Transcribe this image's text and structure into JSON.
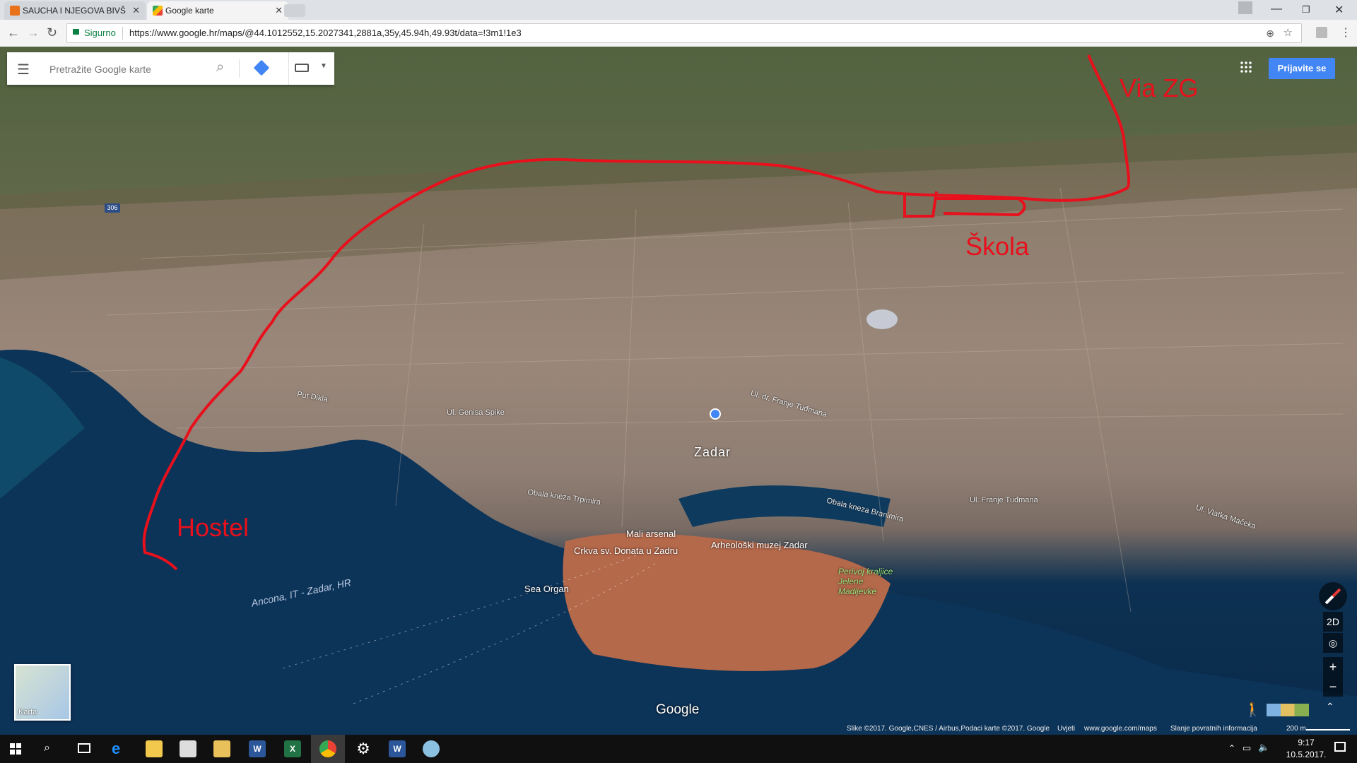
{
  "browser": {
    "tabs": [
      {
        "title": "SAUCHA I NJEGOVA BIVŠ",
        "active": false
      },
      {
        "title": "Google karte",
        "active": true
      }
    ],
    "secure_label": "Sigurno",
    "url": "https://www.google.hr/maps/@44.1012552,15.2027341,2881a,35y,45.94h,49.93t/data=!3m1!1e3"
  },
  "maps_ui": {
    "search_placeholder": "Pretražite Google karte",
    "sign_in_label": "Prijavite se",
    "view_toggle_label": "2D",
    "zoom_in": "+",
    "zoom_out": "−",
    "minimap_label": "Karta",
    "google_logo": "Google",
    "footer": {
      "credits": "Slike ©2017. Google,CNES / Airbus,Podaci karte ©2017. Google",
      "terms": "Uvjeti",
      "site": "www.google.com/maps",
      "feedback": "Slanje povratnih informacija",
      "scale": "200 m"
    }
  },
  "map_labels": {
    "city": "Zadar",
    "poi": [
      "Mali arsenal",
      "Crkva sv. Donata u Zadru",
      "Arheološki muzej Zadar",
      "Sea Organ",
      "Perivoj kraljice Jelene Madijevke"
    ],
    "ferry_route": "Ancona, IT - Zadar, HR",
    "streets": [
      "Obala kneza Trpimira",
      "Obala kneza Branimira",
      "Ul. Franje Tuđmana",
      "Ul. Vlatka Mačeka",
      "Ul. Genisa Spike",
      "Put Dikla",
      "Ul. dr. Franje Tuđmana"
    ],
    "road_number": "306"
  },
  "annotations": {
    "labels": [
      "Via ZG",
      "Škola",
      "Hostel"
    ],
    "color": "#e8101c"
  },
  "taskbar": {
    "apps": [
      "start-icon",
      "search-icon",
      "task-view-icon",
      "edge-icon",
      "explorer-icon",
      "store-icon",
      "folder-icon",
      "word-icon",
      "excel-icon",
      "chrome-icon",
      "settings-icon",
      "word-icon",
      "paint-icon"
    ],
    "time": "9:17",
    "date": "10.5.2017."
  }
}
